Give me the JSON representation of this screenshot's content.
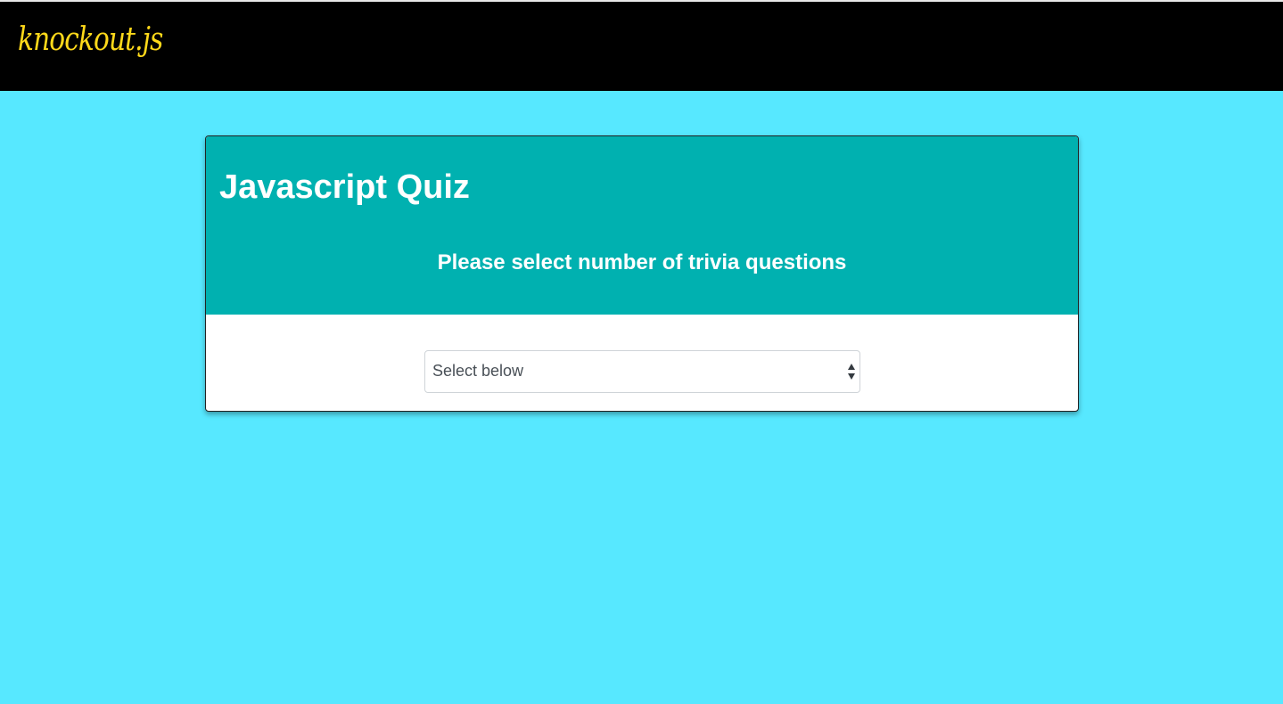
{
  "navbar": {
    "brand": "knockout.js"
  },
  "quiz": {
    "title": "Javascript Quiz",
    "subtitle": "Please select number of trivia questions",
    "select": {
      "value": "Select below"
    }
  },
  "colors": {
    "page_background": "#57e8ff",
    "navbar_background": "#000000",
    "brand_color": "#ffd91a",
    "card_header": "#00b1b0"
  }
}
